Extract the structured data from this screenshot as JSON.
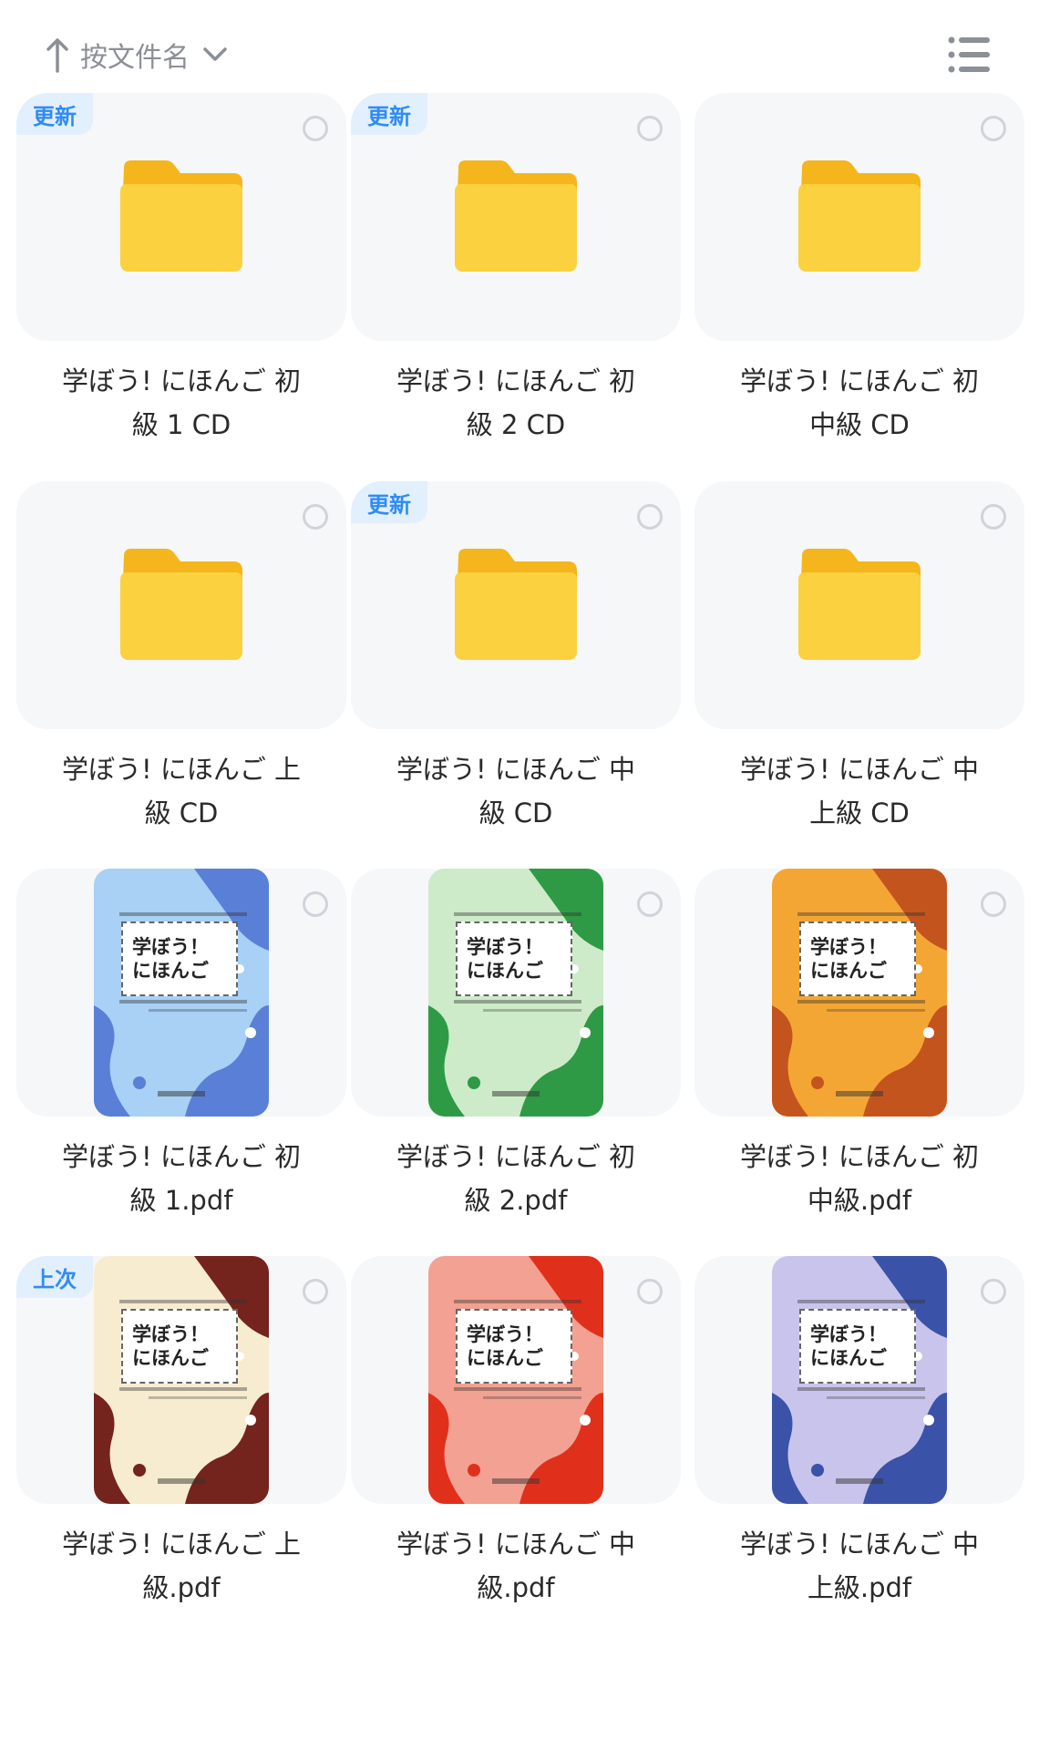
{
  "header": {
    "sort_label": "按文件名",
    "sort_arrow_icon": "arrow-up-icon",
    "sort_chevron_icon": "chevron-down-icon",
    "view_toggle_icon": "list-view-icon"
  },
  "colors": {
    "badge_text": "#2f8cf5",
    "badge_bg": "#e2effd",
    "folder_yellow": "#fcd13f",
    "card_bg": "#f5f7f9"
  },
  "items": [
    {
      "type": "folder",
      "badge": "更新",
      "name_line1": "学ぼう! にほんご 初",
      "name_line2": "級 1 CD"
    },
    {
      "type": "folder",
      "badge": "更新",
      "name_line1": "学ぼう! にほんご 初",
      "name_line2": "級 2 CD"
    },
    {
      "type": "folder",
      "badge": "",
      "name_line1": "学ぼう! にほんご 初",
      "name_line2": "中級 CD"
    },
    {
      "type": "folder",
      "badge": "",
      "name_line1": "学ぼう! にほんご 上",
      "name_line2": "級 CD"
    },
    {
      "type": "folder",
      "badge": "更新",
      "name_line1": "学ぼう! にほんご 中",
      "name_line2": "級 CD"
    },
    {
      "type": "folder",
      "badge": "",
      "name_line1": "学ぼう! にほんご 中",
      "name_line2": "上級 CD"
    },
    {
      "type": "pdf",
      "badge": "",
      "name_line1": "学ぼう! にほんご 初",
      "name_line2": "級 1.pdf",
      "cover_bg": "#a9d0f5",
      "cover_blob": "#5a7fd6",
      "cover_title1": "学ぼう！",
      "cover_title2": "にほんご"
    },
    {
      "type": "pdf",
      "badge": "",
      "name_line1": "学ぼう! にほんご 初",
      "name_line2": "級 2.pdf",
      "cover_bg": "#cdebc8",
      "cover_blob": "#2e9a45",
      "cover_title1": "学ぼう！",
      "cover_title2": "にほんご"
    },
    {
      "type": "pdf",
      "badge": "",
      "name_line1": "学ぼう! にほんご 初",
      "name_line2": "中級.pdf",
      "cover_bg": "#f4a634",
      "cover_blob": "#c4541e",
      "cover_title1": "学ぼう！",
      "cover_title2": "にほんご"
    },
    {
      "type": "pdf",
      "badge": "上次",
      "name_line1": "学ぼう! にほんご 上",
      "name_line2": "級.pdf",
      "cover_bg": "#f7ecd0",
      "cover_blob": "#74231d",
      "cover_title1": "学ぼう！",
      "cover_title2": "にほんご"
    },
    {
      "type": "pdf",
      "badge": "",
      "name_line1": "学ぼう! にほんご 中",
      "name_line2": "級.pdf",
      "cover_bg": "#f3a192",
      "cover_blob": "#e0301c",
      "cover_title1": "学ぼう！",
      "cover_title2": "にほんご"
    },
    {
      "type": "pdf",
      "badge": "",
      "name_line1": "学ぼう! にほんご 中",
      "name_line2": "上級.pdf",
      "cover_bg": "#c9c4ec",
      "cover_blob": "#3a52a8",
      "cover_title1": "学ぼう！",
      "cover_title2": "にほんご"
    }
  ]
}
